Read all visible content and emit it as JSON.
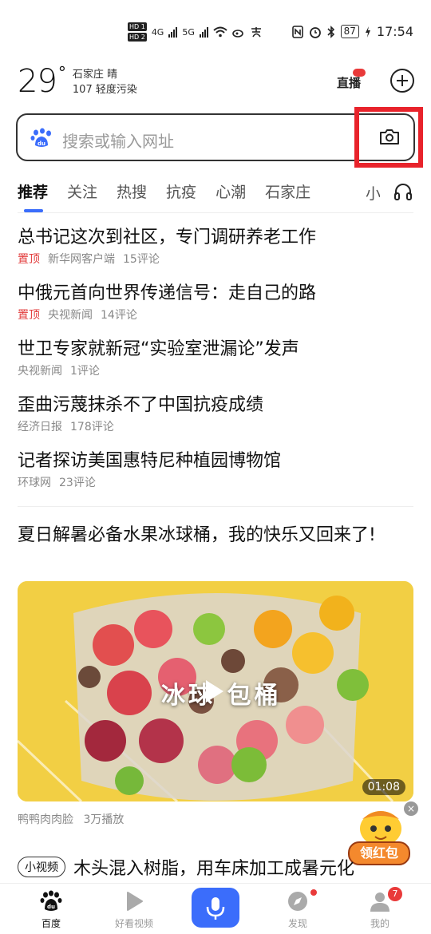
{
  "status_bar": {
    "hd1": "HD 1",
    "hd2": "HD 2",
    "net1": "4G",
    "net2": "5G",
    "battery": "87",
    "time": "17:54"
  },
  "weather": {
    "temperature": "29",
    "degree": "°",
    "city_condition": "石家庄 晴",
    "air_quality": "107 轻度污染"
  },
  "header": {
    "live_label": "直播"
  },
  "search": {
    "placeholder": "搜索或输入网址"
  },
  "tabs": [
    {
      "label": "推荐",
      "active": true
    },
    {
      "label": "关注"
    },
    {
      "label": "热搜"
    },
    {
      "label": "抗疫"
    },
    {
      "label": "心潮"
    },
    {
      "label": "石家庄"
    }
  ],
  "tab_more": "小",
  "news": [
    {
      "title": "总书记这次到社区，专门调研养老工作",
      "pin": "置顶",
      "source": "新华网客户端",
      "comments": "15评论"
    },
    {
      "title": "中俄元首向世界传递信号：走自己的路",
      "pin": "置顶",
      "source": "央视新闻",
      "comments": "14评论"
    },
    {
      "title": "世卫专家就新冠“实验室泄漏论”发声",
      "pin": "",
      "source": "央视新闻",
      "comments": "1评论"
    },
    {
      "title": "歪曲污蔑抹杀不了中国抗疫成绩",
      "pin": "",
      "source": "经济日报",
      "comments": "178评论"
    },
    {
      "title": "记者探访美国惠特尼种植园博物馆",
      "pin": "",
      "source": "环球网",
      "comments": "23评论"
    }
  ],
  "video": {
    "title": "夏日解暑必备水果冰球桶，我的快乐又回来了!",
    "caption": "冰球 包桶",
    "duration": "01:08",
    "author": "鸭鸭肉肉脸",
    "plays": "3万播放"
  },
  "redpack": {
    "label": "领红包",
    "close": "×"
  },
  "small_video": {
    "tag": "小视频",
    "title": "木头混入树脂，用车床加工成暑元化"
  },
  "bottom_nav": {
    "home": "百度",
    "video": "好看视频",
    "discover": "发现",
    "mine": "我的",
    "mine_badge": "7"
  },
  "colors": {
    "accent": "#3b6dfb",
    "pin_red": "#e23c3c",
    "highlight_frame": "#e8232b"
  }
}
